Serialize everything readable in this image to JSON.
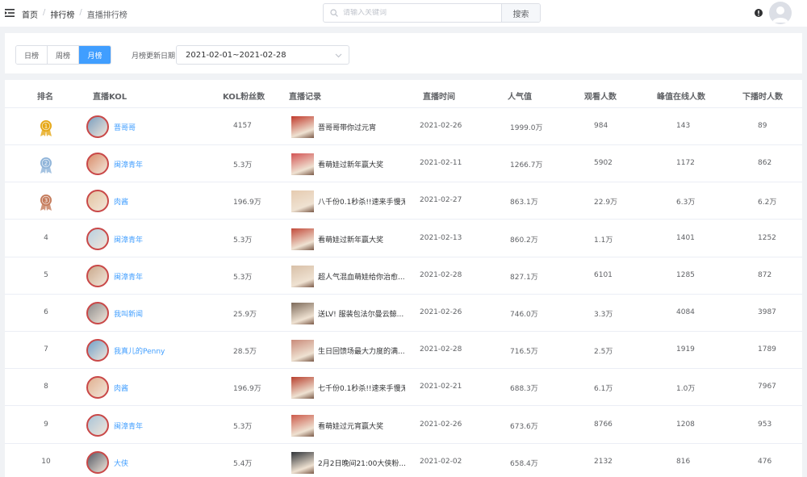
{
  "header": {
    "menu_icon": "menu-fold-icon",
    "breadcrumbs": [
      "首页",
      "排行榜",
      "直播排行榜"
    ],
    "breadcrumb_separator": "/",
    "search_placeholder": "请输入关键词",
    "search_button": "搜索",
    "info_icon": "exclamation-circle-icon",
    "avatar_icon": "user-avatar-icon"
  },
  "filter": {
    "tabs": [
      "日榜",
      "周榜",
      "月榜"
    ],
    "active_tab": "月榜",
    "update_label": "月榜更新日期",
    "date_range": "2021-02-01~2021-02-28"
  },
  "table": {
    "columns": [
      "排名",
      "直播KOL",
      "KOL粉丝数",
      "直播记录",
      "直播时间",
      "人气值",
      "观看人数",
      "峰值在线人数",
      "下播时人数"
    ],
    "rows": [
      {
        "rank": "1",
        "medal": "gold",
        "kol": "晋哥哥",
        "fans": "4157",
        "record": "晋哥哥带你过元宵",
        "time": "2021-02-26",
        "popularity": "1999.0万",
        "viewers": "984",
        "peak": "143",
        "end_viewers": "89"
      },
      {
        "rank": "2",
        "medal": "silver",
        "kol": "闽漳青年",
        "fans": "5.3万",
        "record": "看萌娃过新年赢大奖",
        "time": "2021-02-11",
        "popularity": "1266.7万",
        "viewers": "5902",
        "peak": "1172",
        "end_viewers": "862"
      },
      {
        "rank": "3",
        "medal": "bronze",
        "kol": "肉酱",
        "fans": "196.9万",
        "record": "八千份0.1秒杀!!速来手慢无!!",
        "time": "2021-02-27",
        "popularity": "863.1万",
        "viewers": "22.9万",
        "peak": "6.3万",
        "end_viewers": "6.2万"
      },
      {
        "rank": "4",
        "medal": "",
        "kol": "闽漳青年",
        "fans": "5.3万",
        "record": "看萌娃过新年赢大奖",
        "time": "2021-02-13",
        "popularity": "860.2万",
        "viewers": "1.1万",
        "peak": "1401",
        "end_viewers": "1252"
      },
      {
        "rank": "5",
        "medal": "",
        "kol": "闽漳青年",
        "fans": "5.3万",
        "record": "超人气混血萌娃给你治愈...",
        "time": "2021-02-28",
        "popularity": "827.1万",
        "viewers": "6101",
        "peak": "1285",
        "end_viewers": "872"
      },
      {
        "rank": "6",
        "medal": "",
        "kol": "我叫新闻",
        "fans": "25.9万",
        "record": "送LV! 服装包法尔曼云鲸...",
        "time": "2021-02-26",
        "popularity": "746.0万",
        "viewers": "3.3万",
        "peak": "4084",
        "end_viewers": "3987"
      },
      {
        "rank": "7",
        "medal": "",
        "kol": "我真儿的Penny",
        "fans": "28.5万",
        "record": "生日回馈场最大力度的满...",
        "time": "2021-02-28",
        "popularity": "716.5万",
        "viewers": "2.5万",
        "peak": "1919",
        "end_viewers": "1789"
      },
      {
        "rank": "8",
        "medal": "",
        "kol": "肉酱",
        "fans": "196.9万",
        "record": "七千份0.1秒杀!!速来手慢无!!",
        "time": "2021-02-21",
        "popularity": "688.3万",
        "viewers": "6.1万",
        "peak": "1.0万",
        "end_viewers": "7967"
      },
      {
        "rank": "9",
        "medal": "",
        "kol": "闽漳青年",
        "fans": "5.3万",
        "record": "看萌娃过元宵赢大奖",
        "time": "2021-02-26",
        "popularity": "673.6万",
        "viewers": "8766",
        "peak": "1208",
        "end_viewers": "953"
      },
      {
        "rank": "10",
        "medal": "",
        "kol": "大侠",
        "fans": "5.4万",
        "record": "2月2日晚间21:00大侠粉...",
        "time": "2021-02-02",
        "popularity": "658.4万",
        "viewers": "2132",
        "peak": "816",
        "end_viewers": "476"
      }
    ]
  },
  "colors": {
    "accent": "#409eff",
    "gold": "#e6a817",
    "silver": "#8fb4d9",
    "bronze": "#c47a5a"
  }
}
